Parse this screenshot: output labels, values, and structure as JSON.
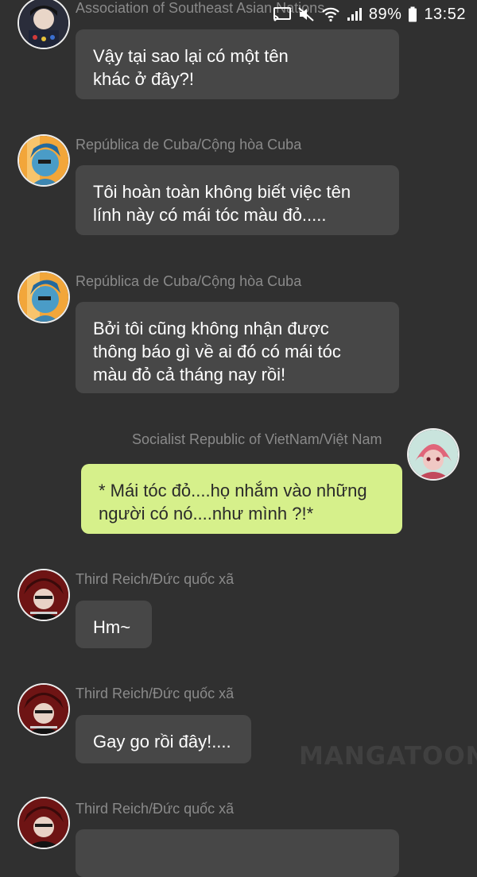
{
  "status_bar": {
    "battery_percent": "89%",
    "time": "13:52",
    "icons": [
      "cast-icon",
      "mute-icon",
      "wifi-icon",
      "signal-icon",
      "battery-icon"
    ]
  },
  "messages": [
    {
      "sender": "Association of Southeast Asian Nations",
      "text": "Vậy tại sao lại có một tên\nkhác ở đây?!",
      "side": "left",
      "avatar": "asean-avatar"
    },
    {
      "sender": "República de Cuba/Cộng hòa Cuba",
      "text": "Tôi hoàn toàn không biết việc tên\nlính này có mái tóc màu đỏ.....",
      "side": "left",
      "avatar": "cuba-avatar"
    },
    {
      "sender": "República de Cuba/Cộng hòa Cuba",
      "text": "Bởi tôi cũng không nhận được\nthông báo gì về ai đó có mái tóc\nmàu đỏ cả tháng nay rồi!",
      "side": "left",
      "avatar": "cuba-avatar"
    },
    {
      "sender": "Socialist Republic of VietNam/Việt  Nam",
      "text": "* Mái tóc đỏ....họ nhắm vào những\nngười có nó....như mình ?!*",
      "side": "right",
      "avatar": "vietnam-avatar"
    },
    {
      "sender": "Third Reich/Đức quốc xã",
      "text": "Hm~",
      "side": "left",
      "avatar": "third-reich-avatar"
    },
    {
      "sender": "Third Reich/Đức quốc xã",
      "text": "Gay go rồi đây!....",
      "side": "left",
      "avatar": "third-reich-avatar"
    },
    {
      "sender": "Third Reich/Đức quốc xã",
      "text": "",
      "side": "left",
      "avatar": "third-reich-avatar"
    }
  ],
  "watermark": "MANGATOON",
  "colors": {
    "background": "#303030",
    "bubble_other": "#474747",
    "bubble_self": "#d6f08b",
    "sender_text": "#8a8a8a"
  }
}
